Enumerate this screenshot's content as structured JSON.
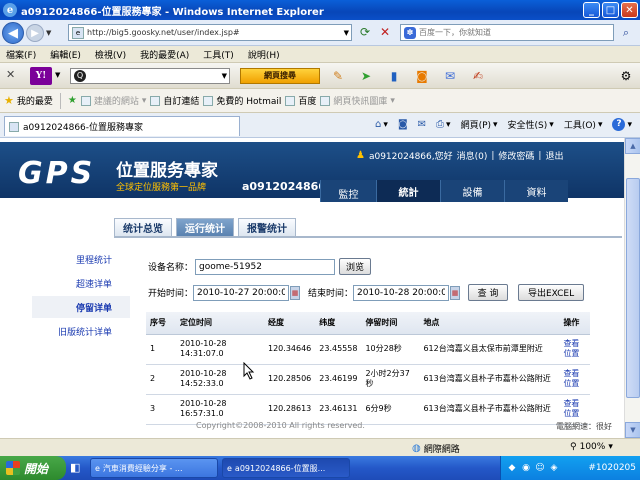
{
  "window": {
    "title": "a0912024866-位置服務專家 - Windows Internet Explorer"
  },
  "address_bar": {
    "url": "http://big5.goosky.net/user/index.jsp#",
    "search_placeholder": "百度一下，你就知道"
  },
  "menu": [
    "檔案(F)",
    "編輯(E)",
    "檢視(V)",
    "我的最愛(A)",
    "工具(T)",
    "說明(H)"
  ],
  "yahoo_toolbar": {
    "logo": "Y!",
    "search_button": "網頁搜尋"
  },
  "favorites_bar": {
    "label": "我的最愛",
    "items": [
      "建議的網站",
      "自訂連結",
      "免費的 Hotmail",
      "百度",
      "網頁快訊圖庫"
    ]
  },
  "tab": {
    "title": "a0912024866-位置服務專家"
  },
  "command_bar": {
    "page": "網頁(P)",
    "safety": "安全性(S)",
    "tools": "工具(O)"
  },
  "site": {
    "logo": "GPS",
    "title": "位置服务專家",
    "subtitle": "全球定位服務第一品牌",
    "user": "a0912024866",
    "greeting": "a0912024866,您好",
    "messages": "消息(0)",
    "change_password": "修改密碼",
    "logout": "退出",
    "separator": "|",
    "nav": [
      "監控",
      "統計",
      "設備",
      "資料"
    ],
    "subtabs": [
      "统计总览",
      "运行统计",
      "报警统计"
    ],
    "sidebar": [
      "里程统计",
      "超速详单",
      "停留详单",
      "旧版统计详单"
    ]
  },
  "form": {
    "device_label": "设备名称：",
    "device_value": "goome-51952",
    "browse_button": "浏览",
    "start_label": "开始时间：",
    "start_value": "2010-10-27 20:00:00",
    "end_label": "结束时间：",
    "end_value": "2010-10-28 20:00:00",
    "query_button": "查 询",
    "export_button": "导出EXCEL"
  },
  "table": {
    "headers": [
      "序号",
      "定位时间",
      "经度",
      "纬度",
      "停留时间",
      "地点",
      "操作"
    ],
    "rows": [
      {
        "no": "1",
        "time": "2010-10-28 14:31:07.0",
        "lng": "120.34646",
        "lat": "23.45558",
        "stay": "10分28秒",
        "place": "612台湾嘉义县太保市前潭里附近",
        "action": "查看位置"
      },
      {
        "no": "2",
        "time": "2010-10-28 14:52:33.0",
        "lng": "120.28506",
        "lat": "23.46199",
        "stay": "2小时2分37秒",
        "place": "613台湾嘉义县朴子市嘉朴公路附近",
        "action": "查看位置"
      },
      {
        "no": "3",
        "time": "2010-10-28 16:57:31.0",
        "lng": "120.28613",
        "lat": "23.46131",
        "stay": "6分9秒",
        "place": "613台湾嘉义县朴子市嘉朴公路附近",
        "action": "查看位置"
      }
    ]
  },
  "footer": {
    "copyright": "Copyright©2008-2010 All rights reserved.",
    "network": "電腦網速：很好"
  },
  "status_bar": {
    "zone": "網際網路",
    "zoom": "100%"
  },
  "taskbar": {
    "start": "開始",
    "tasks": [
      "汽車消費經驗分享 - ...",
      "a0912024866-位置服..."
    ],
    "clock": "#1020205"
  },
  "colors": {
    "header_blue": "#1d4f88",
    "logo_accent": "#ffc000",
    "link_blue": "#1a3ab0"
  }
}
